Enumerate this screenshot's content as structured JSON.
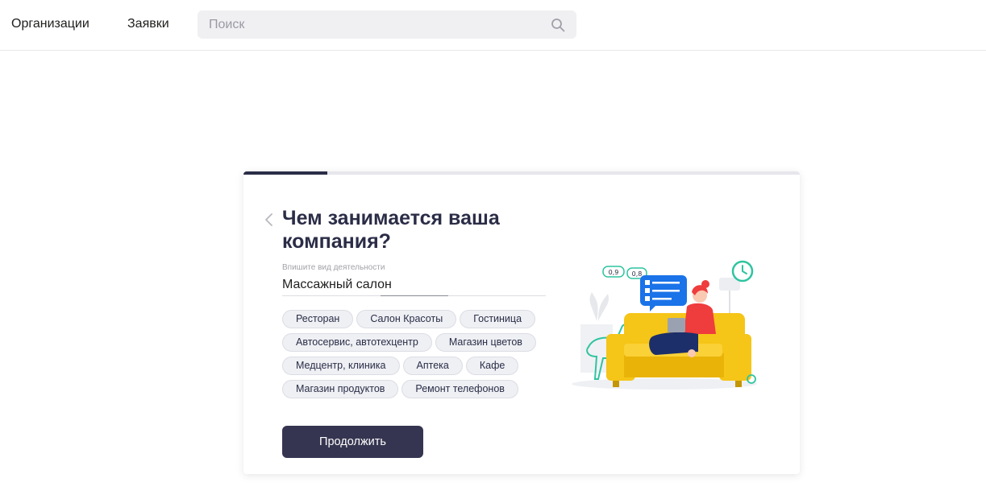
{
  "header": {
    "nav": [
      {
        "label": "Организации"
      },
      {
        "label": "Заявки"
      }
    ],
    "search": {
      "placeholder": "Поиск",
      "value": "",
      "icon": "search-icon"
    }
  },
  "card": {
    "progress": {
      "fraction": 0.15,
      "color": "#2b2d47"
    },
    "title": "Чем занимается ваша компания?",
    "field": {
      "label": "Впишите вид деятельности",
      "value": "Массажный салон"
    },
    "chip_rows": [
      [
        "Ресторан",
        "Салон Красоты",
        "Гостиница"
      ],
      [
        "Автосервис, автотехцентр",
        "Магазин цветов"
      ],
      [
        "Медцентр, клиника",
        "Аптека",
        "Кафе"
      ],
      [
        "Магазин продуктов",
        "Ремонт телефонов"
      ]
    ],
    "continue_label": "Продолжить",
    "illustration": {
      "badges": [
        "0,9",
        "0,8"
      ],
      "sofa_color": "#f5c518",
      "accent_color": "#2fc4a0"
    }
  }
}
